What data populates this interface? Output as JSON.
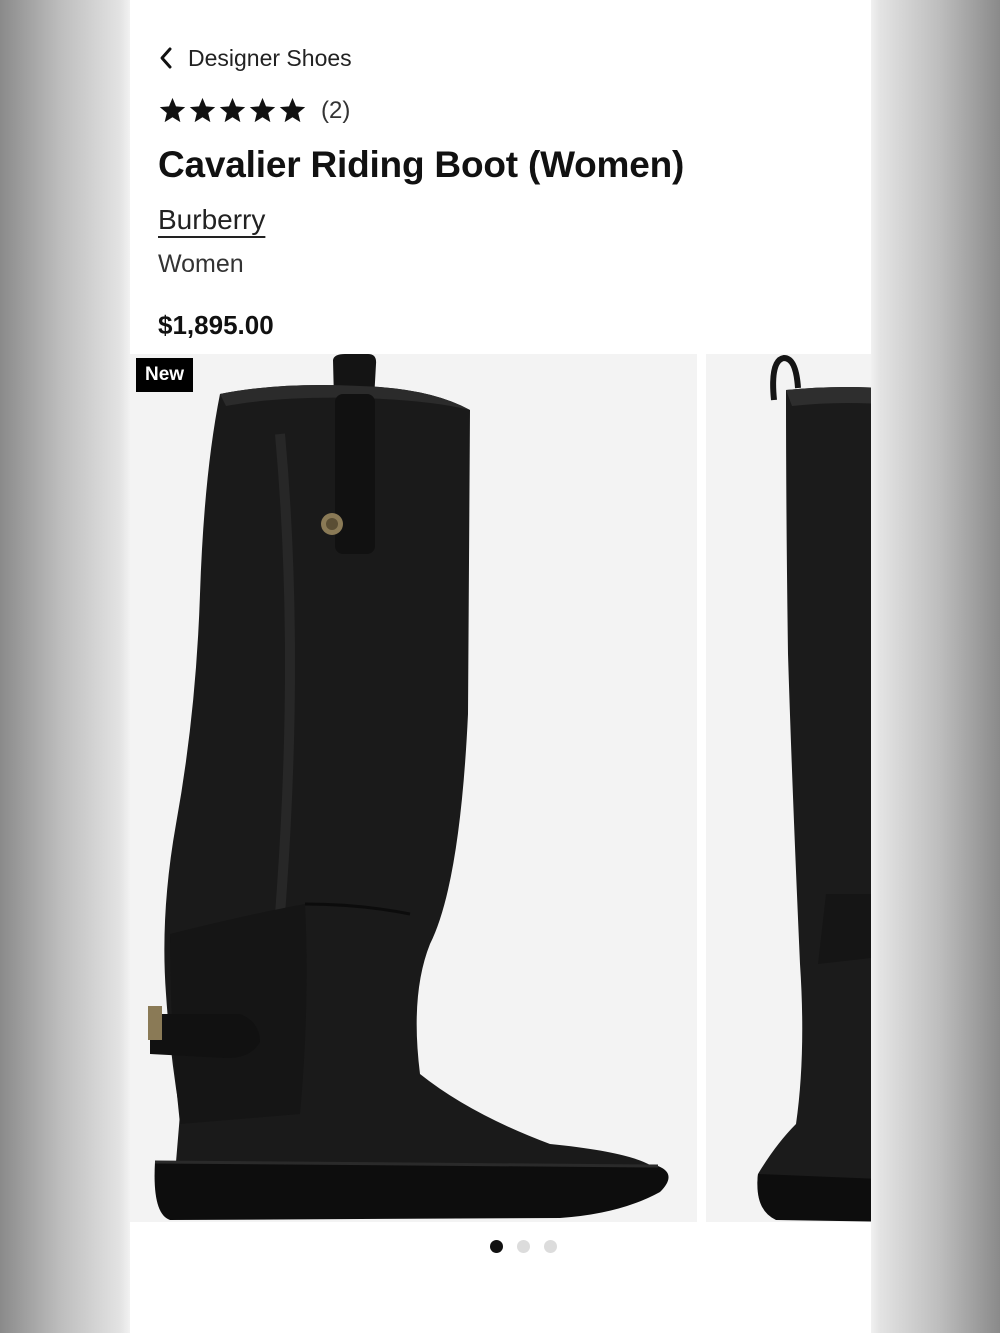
{
  "breadcrumb": {
    "label": "Designer Shoes",
    "icon": "chevron-left-icon"
  },
  "rating": {
    "stars": 5,
    "max_stars": 5,
    "count": "(2)"
  },
  "product": {
    "title": "Cavalier Riding Boot (Women)",
    "brand": "Burberry",
    "category": "Women",
    "price": "$1,895.00"
  },
  "gallery": {
    "badge": "New",
    "images": [
      "boot-side-view",
      "boot-back-view"
    ],
    "active_index": 0,
    "dot_count": 3
  },
  "colors": {
    "text": "#111111",
    "badge_bg": "#000000",
    "image_bg": "#f3f3f3"
  }
}
